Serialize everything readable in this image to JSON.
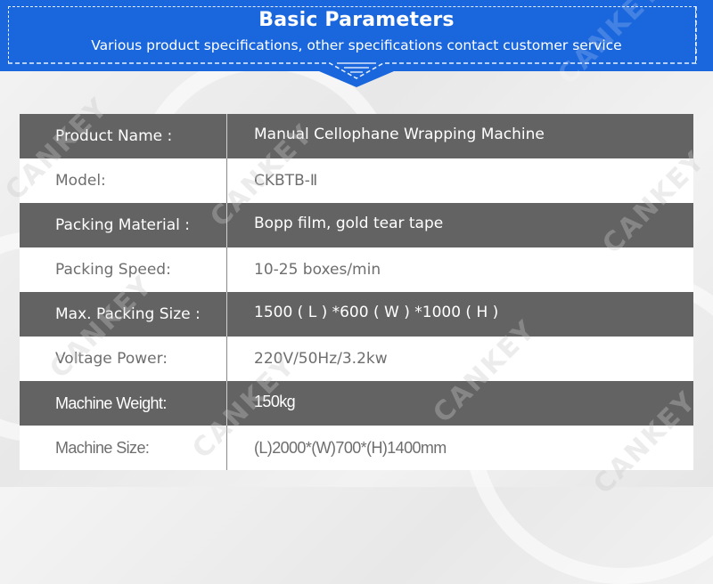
{
  "header": {
    "title": "Basic Parameters",
    "subtitle": "Various product specifications,  other specifications contact customer service",
    "background_color": "#1a66dd"
  },
  "watermark": "CANKEY",
  "specs": [
    {
      "label": "Product Name :",
      "value": "Manual Cellophane Wrapping Machine",
      "style": "dark"
    },
    {
      "label": "Model:",
      "value": "CKBTB-Ⅱ",
      "style": "light"
    },
    {
      "label": "Packing Material :",
      "value": "Bopp film, gold tear tape",
      "style": "dark"
    },
    {
      "label": "Packing Speed:",
      "value": "10-25 boxes/min",
      "style": "light"
    },
    {
      "label": "Max. Packing Size :",
      "value": "1500 ( L ) *600 ( W ) *1000 ( H )",
      "style": "dark"
    },
    {
      "label": "Voltage Power:",
      "value": "220V/50Hz/3.2kw",
      "style": "light"
    },
    {
      "label": "Machine Weight:",
      "value": "150kg",
      "style": "dark"
    },
    {
      "label": "Machine Size:",
      "value": "(L)2000*(W)700*(H)1400mm",
      "style": "light"
    }
  ],
  "colors": {
    "dark_row": "#636363",
    "light_row": "#ffffff",
    "dark_text": "#ffffff",
    "light_text": "#6e6e6e"
  }
}
